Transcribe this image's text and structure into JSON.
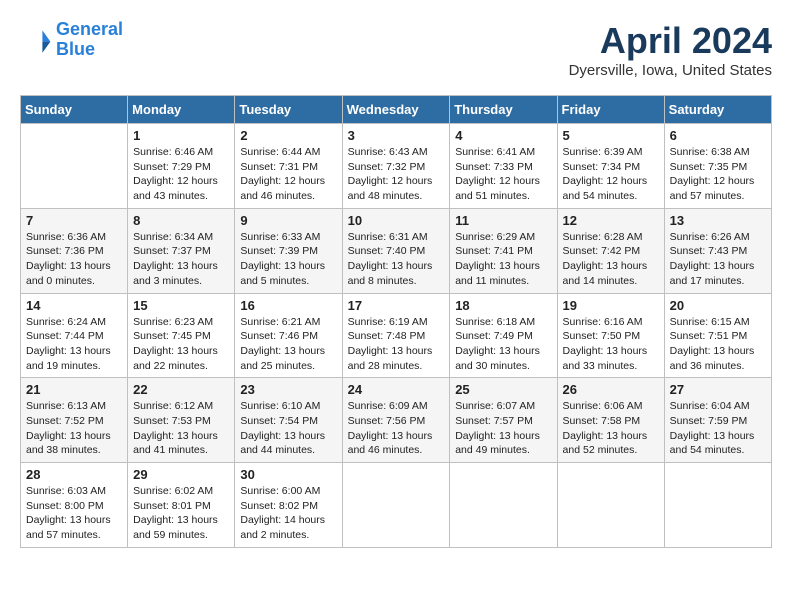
{
  "header": {
    "logo_line1": "General",
    "logo_line2": "Blue",
    "month_year": "April 2024",
    "location": "Dyersville, Iowa, United States"
  },
  "weekdays": [
    "Sunday",
    "Monday",
    "Tuesday",
    "Wednesday",
    "Thursday",
    "Friday",
    "Saturday"
  ],
  "weeks": [
    [
      {
        "day": "",
        "info": ""
      },
      {
        "day": "1",
        "info": "Sunrise: 6:46 AM\nSunset: 7:29 PM\nDaylight: 12 hours\nand 43 minutes."
      },
      {
        "day": "2",
        "info": "Sunrise: 6:44 AM\nSunset: 7:31 PM\nDaylight: 12 hours\nand 46 minutes."
      },
      {
        "day": "3",
        "info": "Sunrise: 6:43 AM\nSunset: 7:32 PM\nDaylight: 12 hours\nand 48 minutes."
      },
      {
        "day": "4",
        "info": "Sunrise: 6:41 AM\nSunset: 7:33 PM\nDaylight: 12 hours\nand 51 minutes."
      },
      {
        "day": "5",
        "info": "Sunrise: 6:39 AM\nSunset: 7:34 PM\nDaylight: 12 hours\nand 54 minutes."
      },
      {
        "day": "6",
        "info": "Sunrise: 6:38 AM\nSunset: 7:35 PM\nDaylight: 12 hours\nand 57 minutes."
      }
    ],
    [
      {
        "day": "7",
        "info": "Sunrise: 6:36 AM\nSunset: 7:36 PM\nDaylight: 13 hours\nand 0 minutes."
      },
      {
        "day": "8",
        "info": "Sunrise: 6:34 AM\nSunset: 7:37 PM\nDaylight: 13 hours\nand 3 minutes."
      },
      {
        "day": "9",
        "info": "Sunrise: 6:33 AM\nSunset: 7:39 PM\nDaylight: 13 hours\nand 5 minutes."
      },
      {
        "day": "10",
        "info": "Sunrise: 6:31 AM\nSunset: 7:40 PM\nDaylight: 13 hours\nand 8 minutes."
      },
      {
        "day": "11",
        "info": "Sunrise: 6:29 AM\nSunset: 7:41 PM\nDaylight: 13 hours\nand 11 minutes."
      },
      {
        "day": "12",
        "info": "Sunrise: 6:28 AM\nSunset: 7:42 PM\nDaylight: 13 hours\nand 14 minutes."
      },
      {
        "day": "13",
        "info": "Sunrise: 6:26 AM\nSunset: 7:43 PM\nDaylight: 13 hours\nand 17 minutes."
      }
    ],
    [
      {
        "day": "14",
        "info": "Sunrise: 6:24 AM\nSunset: 7:44 PM\nDaylight: 13 hours\nand 19 minutes."
      },
      {
        "day": "15",
        "info": "Sunrise: 6:23 AM\nSunset: 7:45 PM\nDaylight: 13 hours\nand 22 minutes."
      },
      {
        "day": "16",
        "info": "Sunrise: 6:21 AM\nSunset: 7:46 PM\nDaylight: 13 hours\nand 25 minutes."
      },
      {
        "day": "17",
        "info": "Sunrise: 6:19 AM\nSunset: 7:48 PM\nDaylight: 13 hours\nand 28 minutes."
      },
      {
        "day": "18",
        "info": "Sunrise: 6:18 AM\nSunset: 7:49 PM\nDaylight: 13 hours\nand 30 minutes."
      },
      {
        "day": "19",
        "info": "Sunrise: 6:16 AM\nSunset: 7:50 PM\nDaylight: 13 hours\nand 33 minutes."
      },
      {
        "day": "20",
        "info": "Sunrise: 6:15 AM\nSunset: 7:51 PM\nDaylight: 13 hours\nand 36 minutes."
      }
    ],
    [
      {
        "day": "21",
        "info": "Sunrise: 6:13 AM\nSunset: 7:52 PM\nDaylight: 13 hours\nand 38 minutes."
      },
      {
        "day": "22",
        "info": "Sunrise: 6:12 AM\nSunset: 7:53 PM\nDaylight: 13 hours\nand 41 minutes."
      },
      {
        "day": "23",
        "info": "Sunrise: 6:10 AM\nSunset: 7:54 PM\nDaylight: 13 hours\nand 44 minutes."
      },
      {
        "day": "24",
        "info": "Sunrise: 6:09 AM\nSunset: 7:56 PM\nDaylight: 13 hours\nand 46 minutes."
      },
      {
        "day": "25",
        "info": "Sunrise: 6:07 AM\nSunset: 7:57 PM\nDaylight: 13 hours\nand 49 minutes."
      },
      {
        "day": "26",
        "info": "Sunrise: 6:06 AM\nSunset: 7:58 PM\nDaylight: 13 hours\nand 52 minutes."
      },
      {
        "day": "27",
        "info": "Sunrise: 6:04 AM\nSunset: 7:59 PM\nDaylight: 13 hours\nand 54 minutes."
      }
    ],
    [
      {
        "day": "28",
        "info": "Sunrise: 6:03 AM\nSunset: 8:00 PM\nDaylight: 13 hours\nand 57 minutes."
      },
      {
        "day": "29",
        "info": "Sunrise: 6:02 AM\nSunset: 8:01 PM\nDaylight: 13 hours\nand 59 minutes."
      },
      {
        "day": "30",
        "info": "Sunrise: 6:00 AM\nSunset: 8:02 PM\nDaylight: 14 hours\nand 2 minutes."
      },
      {
        "day": "",
        "info": ""
      },
      {
        "day": "",
        "info": ""
      },
      {
        "day": "",
        "info": ""
      },
      {
        "day": "",
        "info": ""
      }
    ]
  ]
}
